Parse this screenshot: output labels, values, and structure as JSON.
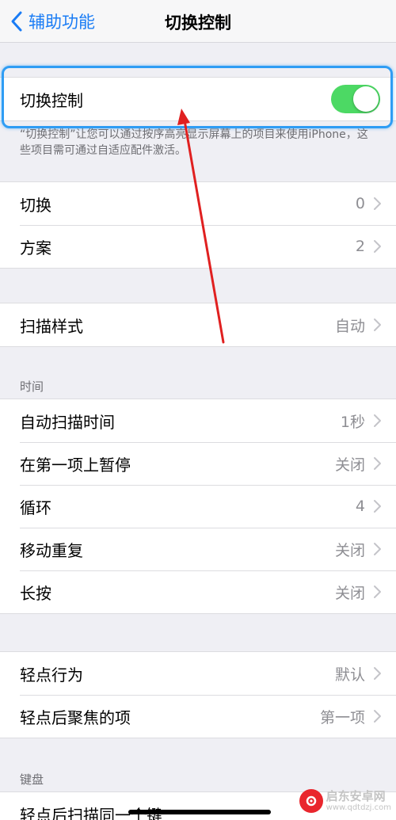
{
  "nav": {
    "back_label": "辅助功能",
    "title": "切换控制"
  },
  "master_switch": {
    "label": "切换控制",
    "enabled": true
  },
  "footnote": "“切换控制”让您可以通过按序高亮显示屏幕上的项目来使用iPhone，这些项目需可通过自适应配件激活。",
  "group_switches": [
    {
      "label": "切换",
      "value": "0"
    },
    {
      "label": "方案",
      "value": "2"
    }
  ],
  "group_style": [
    {
      "label": "扫描样式",
      "value": "自动"
    }
  ],
  "section_timing": {
    "header": "时间",
    "items": [
      {
        "label": "自动扫描时间",
        "value": "1秒"
      },
      {
        "label": "在第一项上暂停",
        "value": "关闭"
      },
      {
        "label": "循环",
        "value": "4"
      },
      {
        "label": "移动重复",
        "value": "关闭"
      },
      {
        "label": "长按",
        "value": "关闭"
      }
    ]
  },
  "group_tap": [
    {
      "label": "轻点行为",
      "value": "默认"
    },
    {
      "label": "轻点后聚焦的项",
      "value": "第一项"
    }
  ],
  "section_keyboard": {
    "header": "键盘",
    "items": [
      {
        "label": "轻点后扫描同一个键"
      }
    ]
  },
  "watermark": {
    "main": "启东安卓网",
    "sub": "www.qdtdzj.com"
  },
  "colors": {
    "accent": "#1a7cf5",
    "toggle_on": "#4cd964",
    "highlight": "#2f9df4",
    "annotation_arrow": "#e02020"
  },
  "icons": {
    "back": "chevron-left-icon",
    "row": "chevron-right-icon"
  }
}
